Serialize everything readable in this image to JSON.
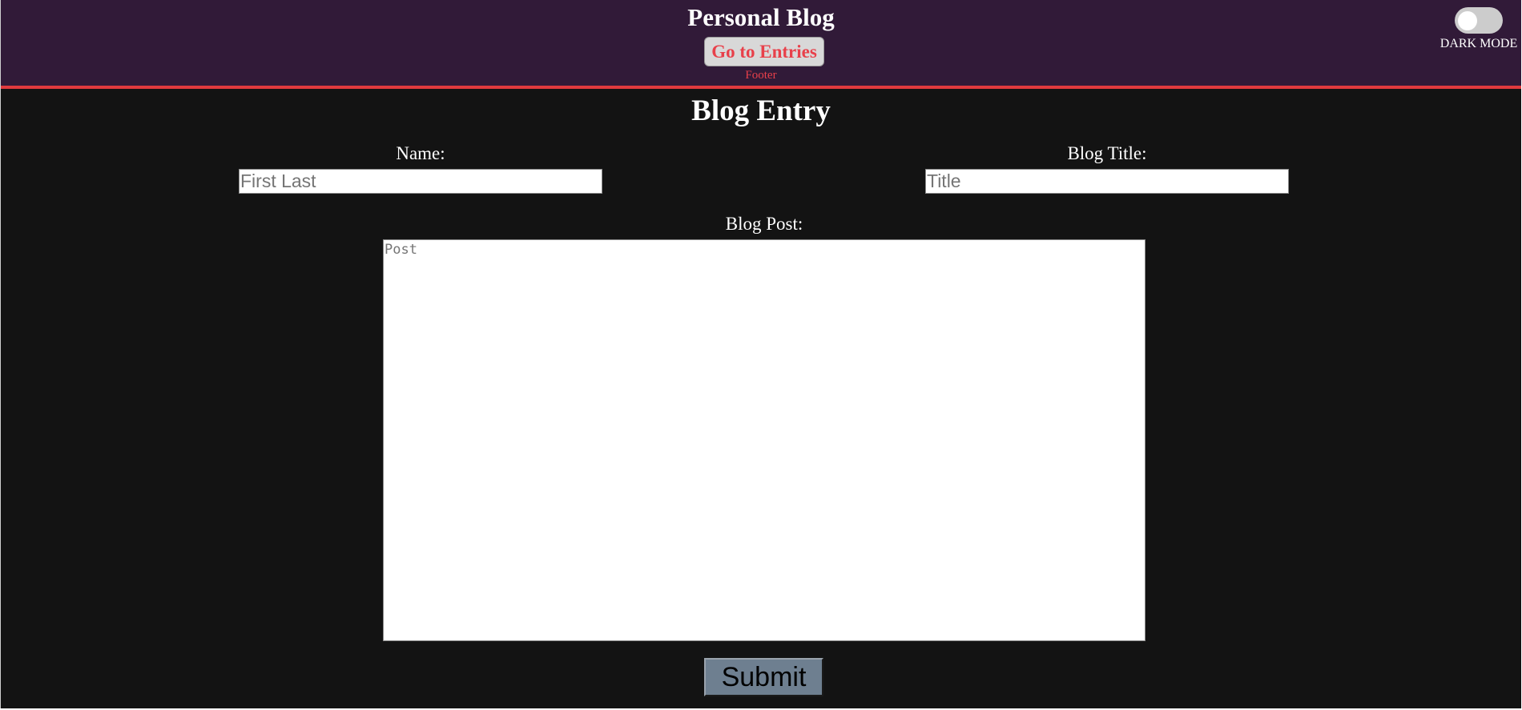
{
  "header": {
    "title": "Personal Blog",
    "go_entries_label": "Go to Entries",
    "footer_label": "Footer",
    "dark_mode_label": "DARK MODE",
    "dark_mode_on": false
  },
  "form": {
    "heading": "Blog Entry",
    "name_label": "Name:",
    "name_placeholder": "First Last",
    "name_value": "",
    "title_label": "Blog Title:",
    "title_placeholder": "Title",
    "title_value": "",
    "post_label": "Blog Post:",
    "post_placeholder": "Post",
    "post_value": "",
    "submit_label": "Submit"
  },
  "colors": {
    "header_bg": "#311a38",
    "accent_red": "#e03a3e",
    "page_bg": "#131313",
    "submit_bg": "#6e7f90"
  }
}
